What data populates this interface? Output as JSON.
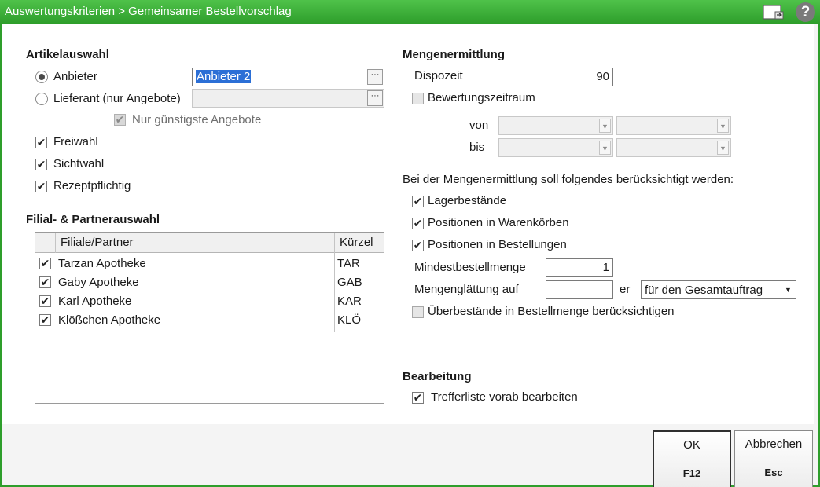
{
  "window": {
    "title": "Auswertungskriterien > Gemeinsamer Bestellvorschlag",
    "help_glyph": "?"
  },
  "artikelauswahl": {
    "title": "Artikelauswahl",
    "anbieter_label": "Anbieter",
    "anbieter_value": "Anbieter 2",
    "lieferant_label": "Lieferant (nur Angebote)",
    "lieferant_value": "",
    "nur_guenstigste_label": "Nur günstigste Angebote",
    "freiwahl_label": "Freiwahl",
    "sichtwahl_label": "Sichtwahl",
    "rezeptpflichtig_label": "Rezeptpflichtig",
    "ellipsis": "···"
  },
  "filial": {
    "title": "Filial- & Partnerauswahl",
    "columns": [
      "Filiale/Partner",
      "Kürzel"
    ],
    "rows": [
      {
        "name": "Tarzan Apotheke",
        "code": "TAR",
        "checked": true
      },
      {
        "name": "Gaby Apotheke",
        "code": "GAB",
        "checked": true
      },
      {
        "name": "Karl Apotheke",
        "code": "KAR",
        "checked": true
      },
      {
        "name": "Klößchen Apotheke",
        "code": "KLÖ",
        "checked": true
      }
    ]
  },
  "menge": {
    "title": "Mengenermittlung",
    "dispozeit_label": "Dispozeit",
    "dispozeit_value": "90",
    "bewertungszeitraum_label": "Bewertungszeitraum",
    "von_label": "von",
    "bis_label": "bis",
    "beruecksichtigt_text": "Bei der Mengenermittlung soll folgendes berücksichtigt werden:",
    "lagerbestaende_label": "Lagerbestände",
    "warenkoerbe_label": "Positionen in Warenkörben",
    "bestellungen_label": "Positionen in Bestellungen",
    "mindest_label": "Mindestbestellmenge",
    "mindest_value": "1",
    "glaettung_label": "Mengenglättung auf",
    "glaettung_value": "",
    "glaettung_suffix": "er",
    "glaettung_option": "für den Gesamtauftrag",
    "ueberbestaende_label": "Überbestände in Bestellmenge berücksichtigen"
  },
  "bearbeitung": {
    "title": "Bearbeitung",
    "trefferliste_label": "Trefferliste vorab bearbeiten"
  },
  "buttons": {
    "ok_label": "OK",
    "ok_key": "F12",
    "cancel_label": "Abbrechen",
    "cancel_key": "Esc"
  },
  "glyphs": {
    "check": "✔",
    "arrow_down": "▼"
  },
  "icons": [
    "window-layout-icon",
    "help-icon"
  ]
}
